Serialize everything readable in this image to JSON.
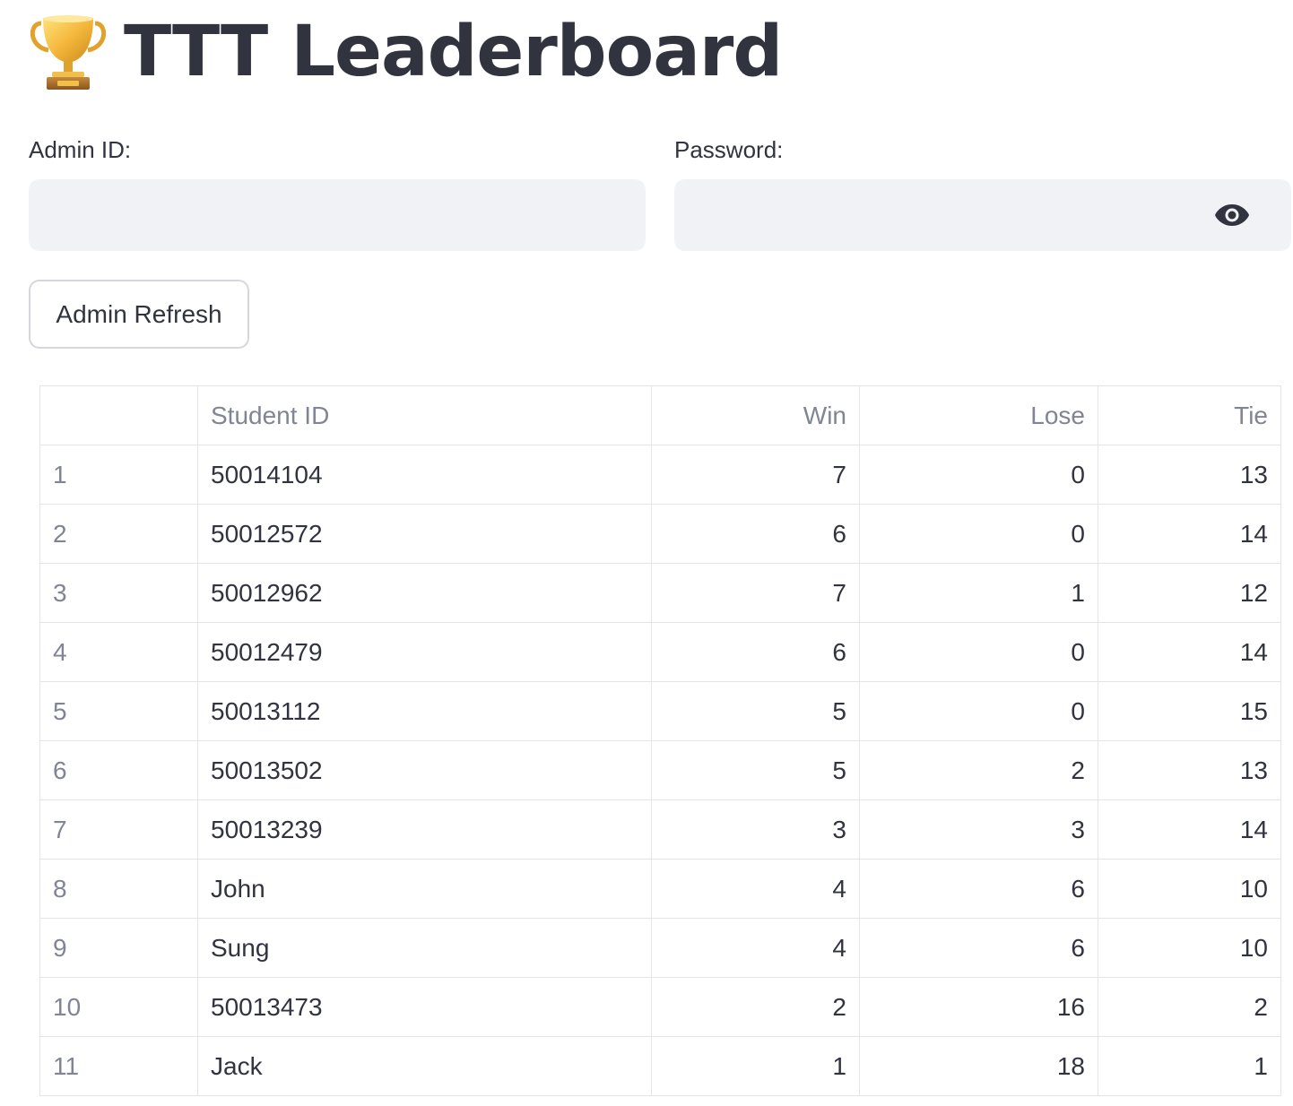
{
  "header": {
    "title": "TTT Leaderboard",
    "icon": "trophy-icon"
  },
  "form": {
    "admin_id_label": "Admin ID:",
    "admin_id_value": "",
    "password_label": "Password:",
    "password_value": "",
    "password_toggle_icon": "eye-icon",
    "refresh_button_label": "Admin Refresh"
  },
  "table": {
    "columns": [
      "",
      "Student ID",
      "Win",
      "Lose",
      "Tie"
    ],
    "rows": [
      {
        "index": "1",
        "student_id": "50014104",
        "win": "7",
        "lose": "0",
        "tie": "13"
      },
      {
        "index": "2",
        "student_id": "50012572",
        "win": "6",
        "lose": "0",
        "tie": "14"
      },
      {
        "index": "3",
        "student_id": "50012962",
        "win": "7",
        "lose": "1",
        "tie": "12"
      },
      {
        "index": "4",
        "student_id": "50012479",
        "win": "6",
        "lose": "0",
        "tie": "14"
      },
      {
        "index": "5",
        "student_id": "50013112",
        "win": "5",
        "lose": "0",
        "tie": "15"
      },
      {
        "index": "6",
        "student_id": "50013502",
        "win": "5",
        "lose": "2",
        "tie": "13"
      },
      {
        "index": "7",
        "student_id": "50013239",
        "win": "3",
        "lose": "3",
        "tie": "14"
      },
      {
        "index": "8",
        "student_id": "John",
        "win": "4",
        "lose": "6",
        "tie": "10"
      },
      {
        "index": "9",
        "student_id": "Sung",
        "win": "4",
        "lose": "6",
        "tie": "10"
      },
      {
        "index": "10",
        "student_id": "50013473",
        "win": "2",
        "lose": "16",
        "tie": "2"
      },
      {
        "index": "11",
        "student_id": "Jack",
        "win": "1",
        "lose": "18",
        "tie": "1"
      }
    ]
  },
  "colors": {
    "text": "#31333f",
    "muted": "#808495",
    "input_bg": "#f0f2f6",
    "border": "#e4e5e9"
  }
}
